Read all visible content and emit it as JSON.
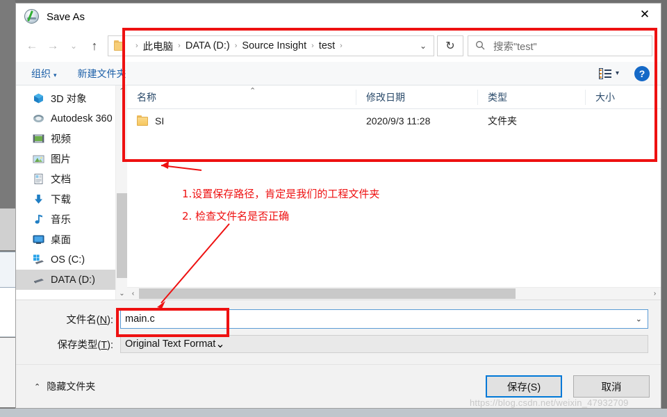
{
  "window": {
    "title": "Save As",
    "app_icon": "source-insight-icon",
    "close_label": "✕"
  },
  "address_bar": {
    "back_icon": "←",
    "forward_icon": "→",
    "recent_icon": "⌄",
    "up_icon": "↑",
    "folder_icon": "folder-icon",
    "breadcrumbs": [
      "此电脑",
      "DATA (D:)",
      "Source Insight",
      "test"
    ],
    "separator": "›",
    "dropdown_icon": "⌄",
    "refresh_icon": "↻",
    "search_icon": "⚲",
    "search_placeholder": "搜索\"test\""
  },
  "toolbar": {
    "organize_label": "组织",
    "organize_caret": "▾",
    "new_folder_label": "新建文件夹",
    "view_icon": "change-view-icon",
    "view_caret": "▾",
    "help_label": "?"
  },
  "nav_pane": {
    "items": [
      {
        "label": "3D 对象",
        "icon": "3d-objects-icon",
        "selected": false
      },
      {
        "label": "Autodesk 360",
        "icon": "autodesk-icon",
        "selected": false
      },
      {
        "label": "视频",
        "icon": "videos-icon",
        "selected": false
      },
      {
        "label": "图片",
        "icon": "pictures-icon",
        "selected": false
      },
      {
        "label": "文档",
        "icon": "documents-icon",
        "selected": false
      },
      {
        "label": "下载",
        "icon": "downloads-icon",
        "selected": false
      },
      {
        "label": "音乐",
        "icon": "music-icon",
        "selected": false
      },
      {
        "label": "桌面",
        "icon": "desktop-icon",
        "selected": false
      },
      {
        "label": "OS (C:)",
        "icon": "windows-drive-icon",
        "selected": false
      },
      {
        "label": "DATA (D:)",
        "icon": "drive-icon",
        "selected": true
      }
    ],
    "scroll_up_icon": "⌃",
    "scroll_down_icon": "⌄"
  },
  "file_list": {
    "columns": [
      "名称",
      "修改日期",
      "类型",
      "大小"
    ],
    "sort_indicator": "⌃",
    "rows": [
      {
        "name": "SI",
        "date": "2020/9/3 11:28",
        "type": "文件夹",
        "size": "",
        "icon": "folder-icon"
      }
    ],
    "hscroll_left_icon": "‹",
    "hscroll_right_icon": "›"
  },
  "form": {
    "filename_label_prefix": "文件名(",
    "filename_label_key": "N",
    "filename_label_suffix": "):",
    "filename_value": "main.c",
    "filename_caret": "⌄",
    "filetype_label_prefix": "保存类型(",
    "filetype_label_key": "T",
    "filetype_label_suffix": "):",
    "filetype_value": "Original Text Format",
    "filetype_caret": "⌄"
  },
  "footer": {
    "hide_folders_chevron": "⌃",
    "hide_folders_label": "隐藏文件夹",
    "save_label": "保存(S)",
    "cancel_label": "取消"
  },
  "annotations": {
    "color": "#ee1111",
    "note_1": "1.设置保存路径，肯定是我们的工程文件夹",
    "note_2": "2. 检查文件名是否正确"
  },
  "watermark": "https://blog.csdn.net/weixin_47932709"
}
